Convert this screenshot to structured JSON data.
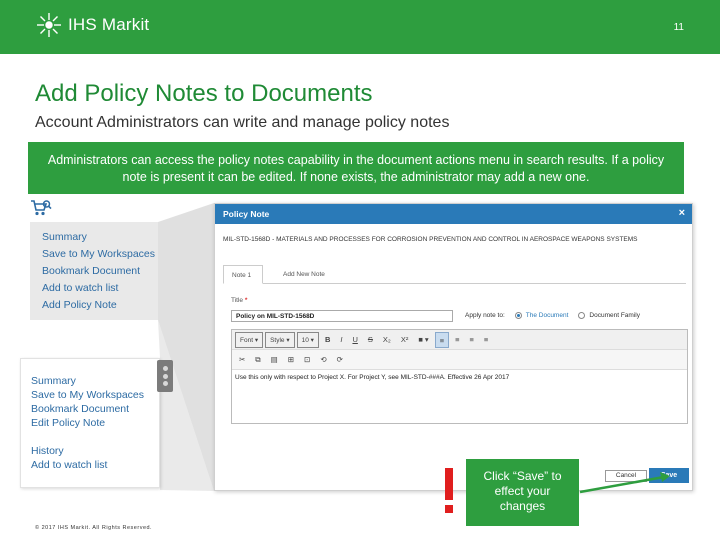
{
  "slide": {
    "logo_text": "IHS Markit",
    "page_number": "11",
    "title": "Add Policy Notes to Documents",
    "subtitle": "Account Administrators can write and manage policy notes",
    "banner_text": "Administrators can access the policy notes capability in the document actions menu in search results. If a policy note is present it can be edited. If none exists, the administrator may add a new one.",
    "copyright": "© 2017 IHS Markit. All Rights Reserved.",
    "callout_text": "Click “Save” to effect your changes",
    "exclamation": "!"
  },
  "menu_add": {
    "items": [
      "Summary",
      "Save to My Workspaces",
      "Bookmark Document",
      "Add to watch list",
      "Add Policy Note"
    ]
  },
  "menu_edit": {
    "items_top": [
      "Summary",
      "Save to My Workspaces",
      "Bookmark Document",
      "Edit Policy Note"
    ],
    "items_bottom": [
      "History",
      "Add to watch list"
    ]
  },
  "dialog": {
    "header": "Policy Note",
    "close_icon": "×",
    "doc_title": "MIL-STD-1568D - MATERIALS AND PROCESSES FOR CORROSION PREVENTION AND CONTROL IN AEROSPACE WEAPONS SYSTEMS",
    "tabs": [
      "Note 1",
      "Add New Note"
    ],
    "title_label": "Title",
    "required_mark": "*",
    "title_value": "Policy on MIL-STD-1568D",
    "apply_label": "Apply note to:",
    "apply_options": [
      "The Document",
      "Document Family"
    ],
    "apply_selected": "The Document",
    "toolbar_row1": {
      "font": "Font",
      "style": "Style",
      "size": "10",
      "bold": "B",
      "italic": "I",
      "underline": "U",
      "strike": "S",
      "subscript": "X₂",
      "superscript": "X²",
      "color": "■",
      "align_left": "≡",
      "align_center": "≡",
      "align_right": "≡",
      "justify": "≡"
    },
    "toolbar_row2": [
      "✂",
      "⧉",
      "▤",
      "⊞",
      "⊡",
      "⟲",
      "⟳"
    ],
    "editor_text": "Use this only with respect to Project X. For Project Y, see MIL-STD-###A. Effective 26 Apr 2017",
    "cancel_label": "Cancel",
    "save_label": "Save"
  },
  "colors": {
    "brand_green": "#2e9e3f",
    "dialog_blue": "#2a7ab8",
    "link_blue": "#2d6ba3",
    "alert_red": "#e01e1e"
  },
  "icons": [
    "cart-icon",
    "search-icon",
    "close-icon",
    "kebab-menu-icon",
    "arrow-icon"
  ]
}
